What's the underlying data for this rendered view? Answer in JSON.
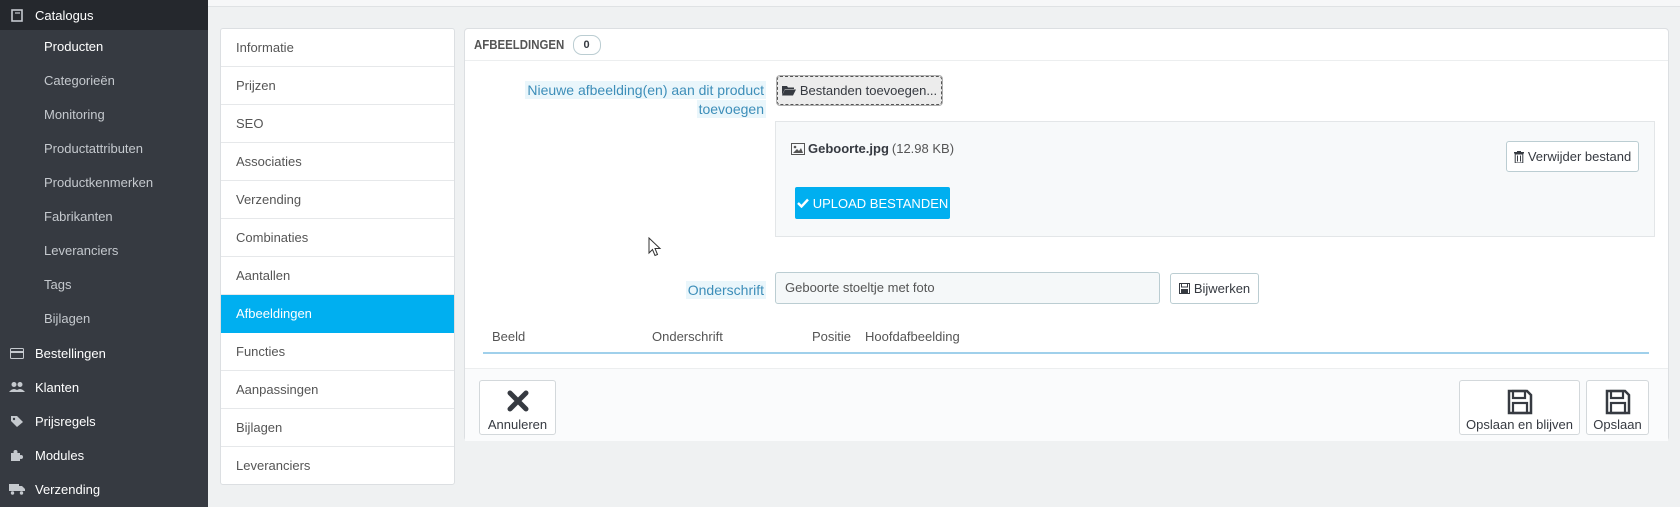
{
  "sidebar": {
    "catalog_label": "Catalogus",
    "sub_items": [
      "Producten",
      "Categorieën",
      "Monitoring",
      "Productattributen",
      "Productkenmerken",
      "Fabrikanten",
      "Leveranciers",
      "Tags",
      "Bijlagen"
    ],
    "main_items": [
      {
        "label": "Bestellingen",
        "icon": "credit-card-icon"
      },
      {
        "label": "Klanten",
        "icon": "users-icon"
      },
      {
        "label": "Prijsregels",
        "icon": "tags-icon"
      },
      {
        "label": "Modules",
        "icon": "puzzle-icon"
      },
      {
        "label": "Verzending",
        "icon": "truck-icon"
      }
    ]
  },
  "tabs": [
    "Informatie",
    "Prijzen",
    "SEO",
    "Associaties",
    "Verzending",
    "Combinaties",
    "Aantallen",
    "Afbeeldingen",
    "Functies",
    "Aanpassingen",
    "Bijlagen",
    "Leveranciers"
  ],
  "active_tab": "Afbeeldingen",
  "panel": {
    "title": "AFBEELDINGEN",
    "count": "0",
    "new_image_label_line1": "Nieuwe afbeelding(en) aan dit product",
    "new_image_label_line2": "toevoegen",
    "add_files_button": "Bestanden toevoegen...",
    "file_name": "Geboorte.jpg",
    "file_size": "(12.98 KB)",
    "remove_file_button": "Verwijder bestand",
    "upload_button": "UPLOAD BESTANDEN",
    "caption_label": "Onderschrift",
    "caption_value": "Geboorte stoeltje met foto",
    "update_button": "Bijwerken",
    "table_headers": [
      "Beeld",
      "Onderschrift",
      "Positie",
      "Hoofdafbeelding"
    ]
  },
  "footer": {
    "cancel_button": "Annuleren",
    "save_stay_button": "Opslaan en blijven",
    "save_button": "Opslaan"
  },
  "colors": {
    "sidebar": "#363a41",
    "accent": "#00aff0",
    "label": "#3d8eb9"
  }
}
